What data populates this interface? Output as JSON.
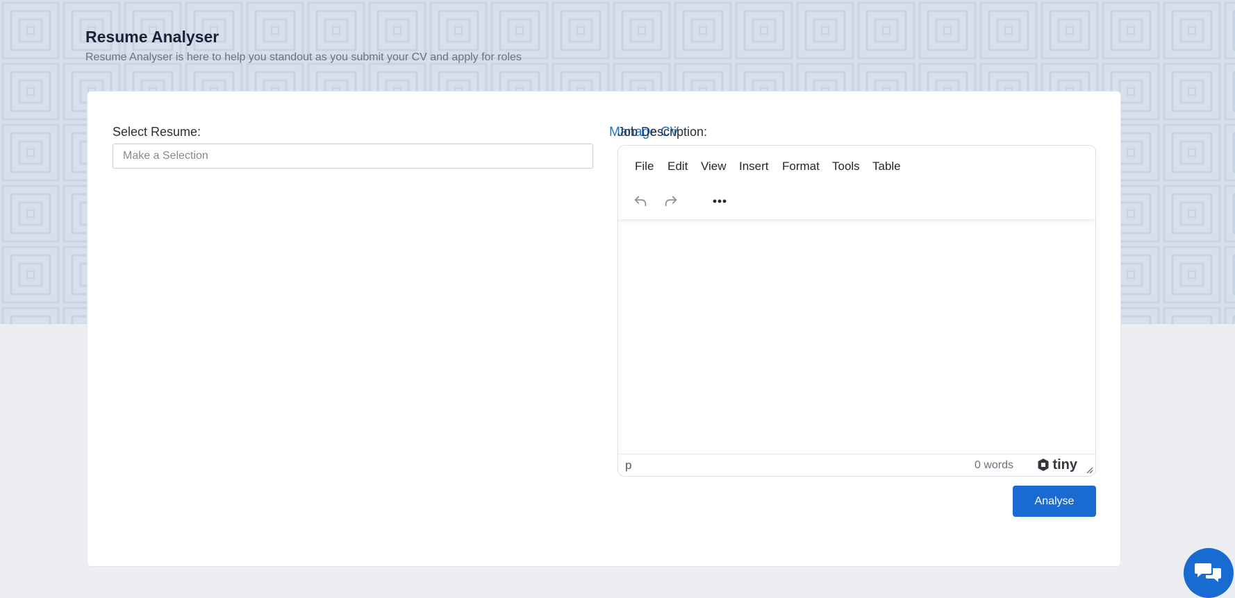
{
  "header": {
    "title": "Resume Analyser",
    "subtitle": "Resume Analyser is here to help you standout as you submit your CV and apply for roles"
  },
  "resume": {
    "label": "Select Resume:",
    "manage_link": "Manage CV",
    "placeholder": "Make a Selection"
  },
  "job_description": {
    "label": "Job Description:",
    "menu": [
      "File",
      "Edit",
      "View",
      "Insert",
      "Format",
      "Tools",
      "Table"
    ],
    "toolbar": {
      "undo_icon": "undo-icon",
      "redo_icon": "redo-icon",
      "more_icon": "more-horizontal-icon"
    },
    "status_path": "p",
    "word_count": "0 words",
    "brand": "tiny"
  },
  "actions": {
    "analyse_label": "Analyse"
  },
  "chat": {
    "icon": "chat-icon"
  },
  "colors": {
    "accent": "#1a6bd1",
    "link": "#1d74d6",
    "hero_bg": "#d6dfec",
    "page_bg": "#eceef2"
  }
}
